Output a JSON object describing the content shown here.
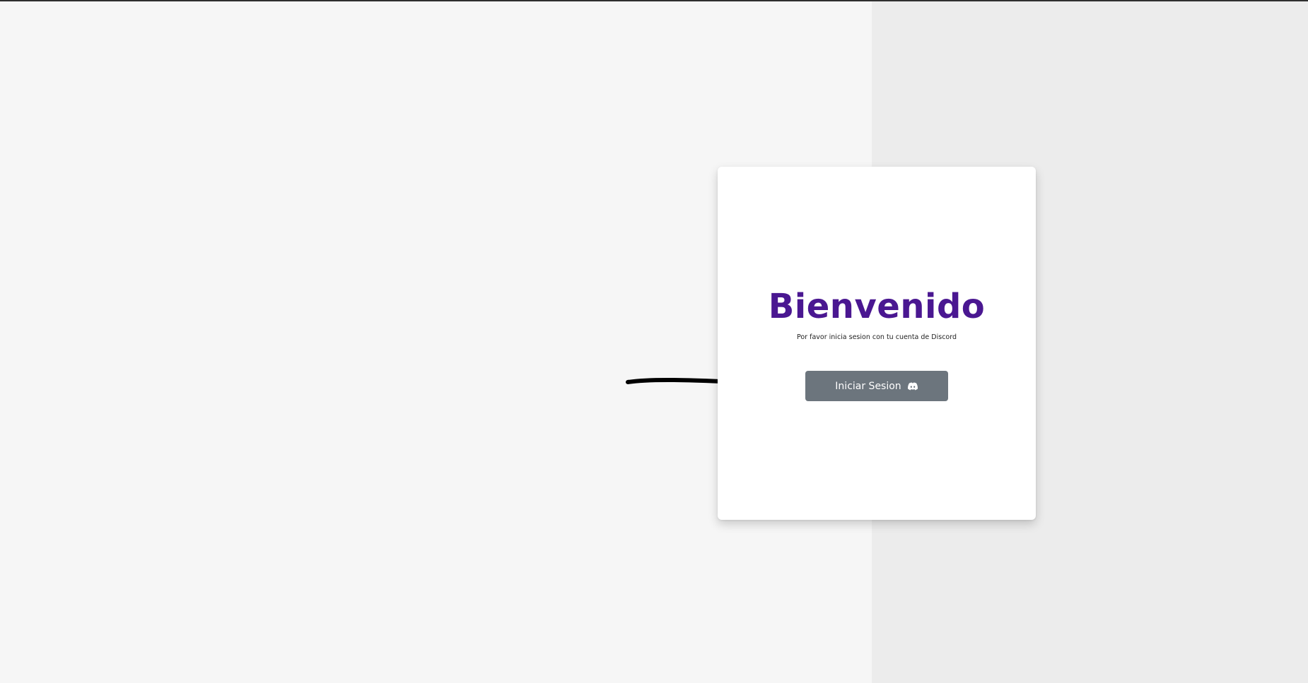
{
  "page": {
    "title": "Bienvenido",
    "subtitle": "Por favor inicia sesion con tu cuenta de Discord"
  },
  "login_button": {
    "label": "Iniciar Sesion",
    "icon": "discord-icon"
  },
  "annotation": {
    "icon": "arrow-right-icon"
  },
  "colors": {
    "title": "#4a1791",
    "button_bg": "#6c757d",
    "button_text": "#ffffff",
    "card_bg": "#ffffff"
  }
}
